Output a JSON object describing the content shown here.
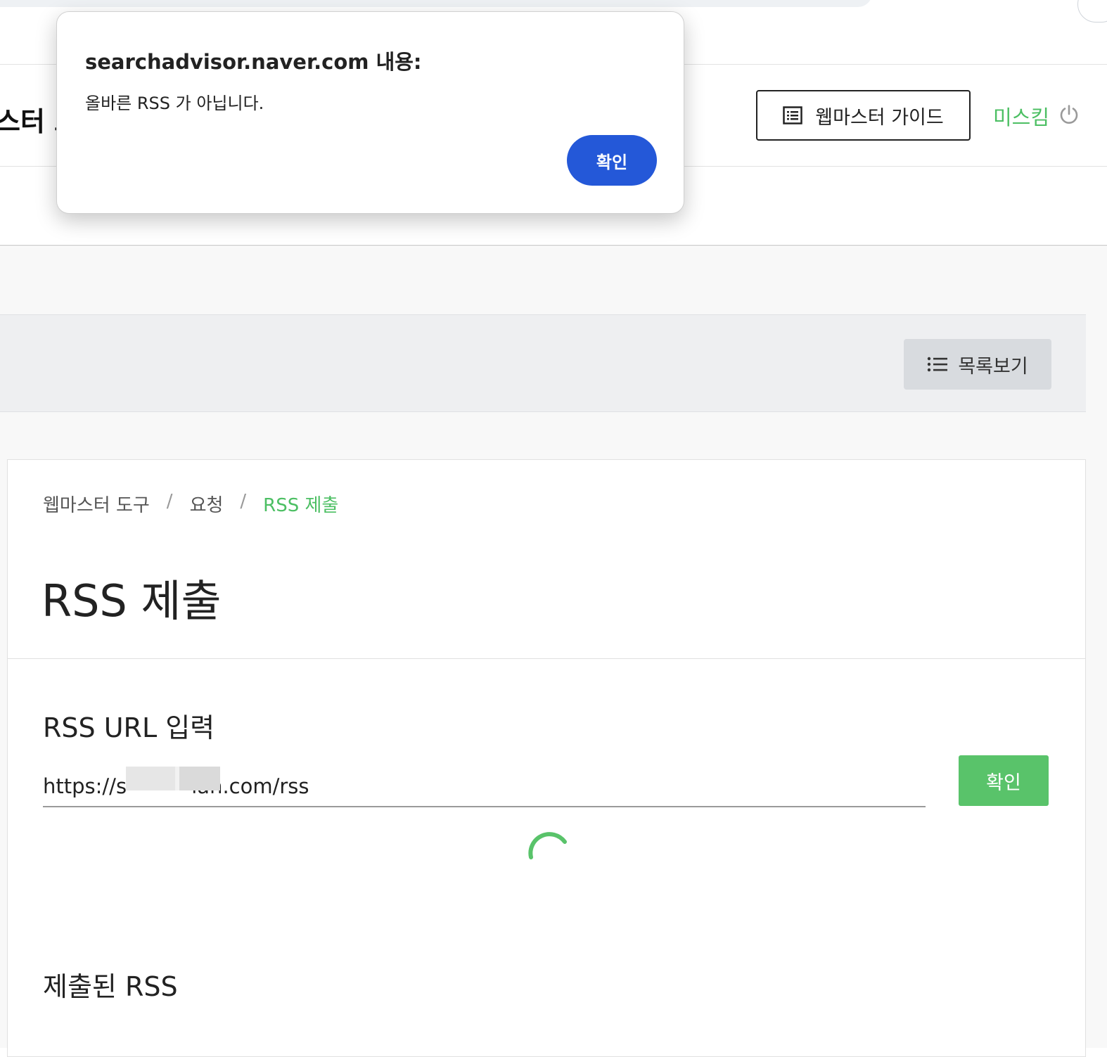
{
  "header": {
    "title_fragment": "스터 도",
    "guide_button": "웹마스터 가이드",
    "user_name": "미스킴",
    "accent_color": "#4cbf63"
  },
  "toolbar": {
    "list_button": "목록보기"
  },
  "breadcrumb": {
    "items": [
      "웹마스터 도구",
      "요청",
      "RSS 제출"
    ],
    "separator": "/"
  },
  "main": {
    "page_title": "RSS 제출",
    "rss_url_label": "RSS URL 입력",
    "rss_url_value": "https://s          lan.com/rss",
    "submit_button": "확인",
    "submitted_title": "제출된 RSS"
  },
  "dialog": {
    "title": "searchadvisor.naver.com 내용:",
    "message": "올바른 RSS 가 아닙니다.",
    "ok_button": "확인",
    "ok_color": "#2458d8"
  },
  "icons": {
    "guide": "document-list-icon",
    "power": "power-icon",
    "list": "list-icon",
    "loading": "loading-spinner-icon"
  }
}
